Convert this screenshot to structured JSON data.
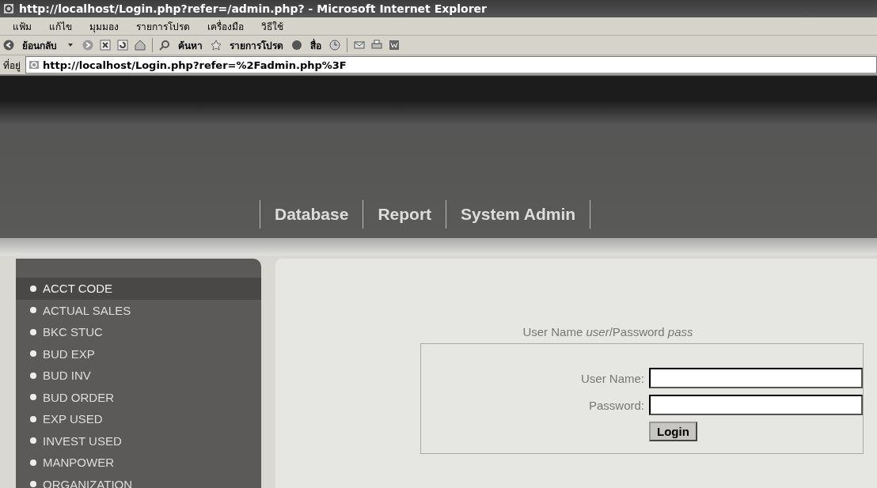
{
  "window": {
    "title": "http://localhost/Login.php?refer=/admin.php? - Microsoft Internet Explorer"
  },
  "menu": [
    "แฟ้ม",
    "แก้ไข",
    "มุมมอง",
    "รายการโปรด",
    "เครื่องมือ",
    "วิธีใช้"
  ],
  "toolbar": {
    "back": "ย้อนกลับ",
    "search": "ค้นหา",
    "favorites": "รายการโปรด",
    "media": "สื่อ"
  },
  "address": {
    "label": "ที่อยู่",
    "value": "http://localhost/Login.php?refer=%2Fadmin.php%3F"
  },
  "nav": [
    "Database",
    "Report",
    "System Admin"
  ],
  "sidebar": {
    "items": [
      {
        "label": "ACCT CODE",
        "selected": true
      },
      {
        "label": "ACTUAL SALES",
        "selected": false
      },
      {
        "label": "BKC STUC",
        "selected": false
      },
      {
        "label": "BUD EXP",
        "selected": false
      },
      {
        "label": "BUD INV",
        "selected": false
      },
      {
        "label": "BUD ORDER",
        "selected": false
      },
      {
        "label": "EXP USED",
        "selected": false
      },
      {
        "label": "INVEST USED",
        "selected": false
      },
      {
        "label": "MANPOWER",
        "selected": false
      },
      {
        "label": "ORGANIZATION",
        "selected": false
      }
    ]
  },
  "login": {
    "hint": "User Name *user*/Password *pass*",
    "user_label": "User Name:",
    "password_label": "Password:",
    "button": "Login"
  }
}
